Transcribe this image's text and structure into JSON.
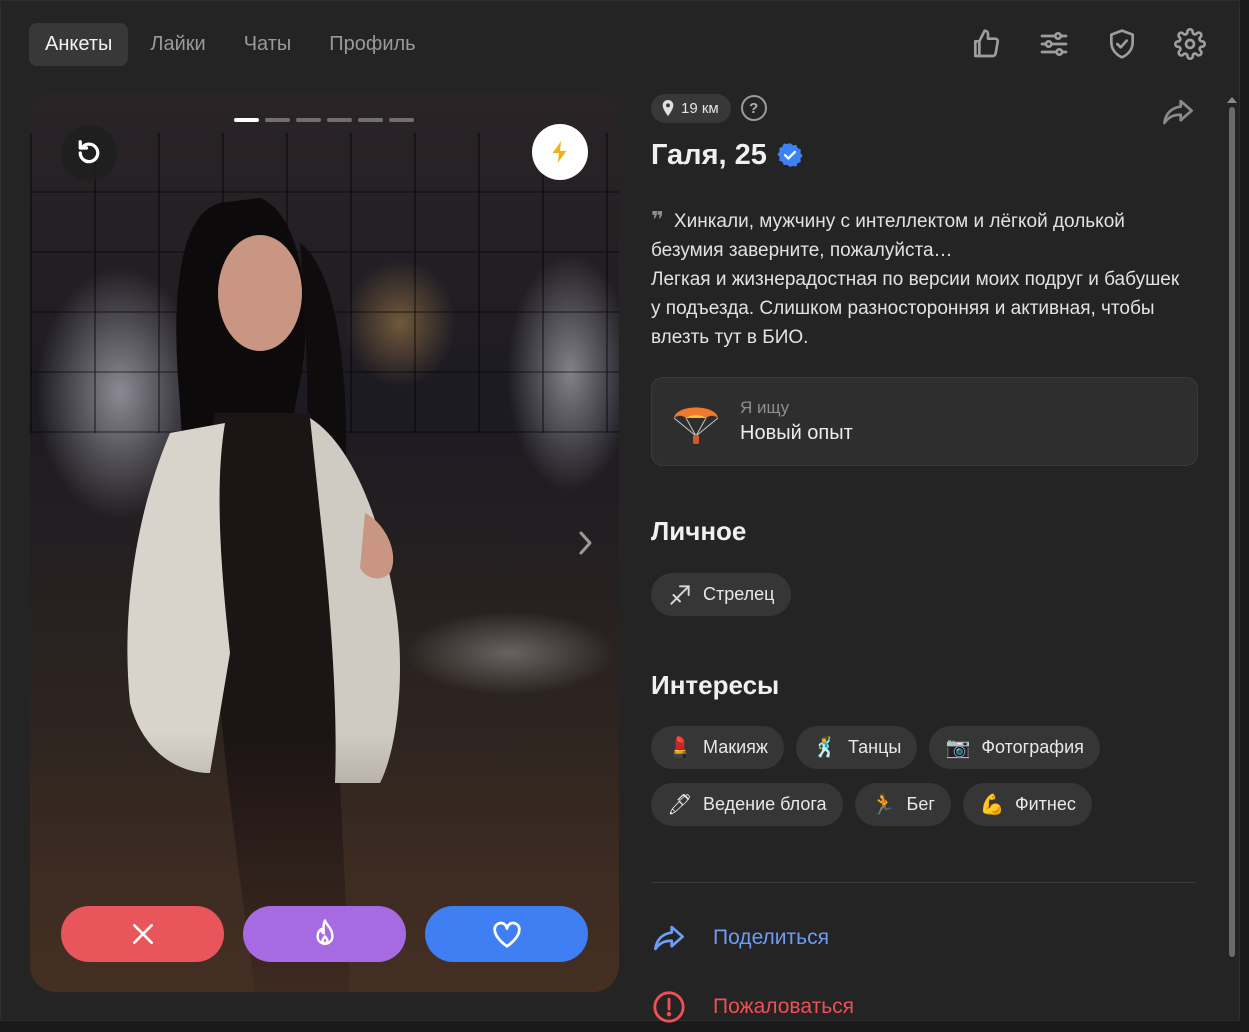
{
  "nav": {
    "tabs": [
      {
        "label": "Анкеты",
        "active": true
      },
      {
        "label": "Лайки",
        "active": false
      },
      {
        "label": "Чаты",
        "active": false
      },
      {
        "label": "Профиль",
        "active": false
      }
    ],
    "icons": [
      "thumbs-up-icon",
      "filters-icon",
      "shield-check-icon",
      "gear-icon"
    ]
  },
  "photo": {
    "count": 6,
    "current": 1,
    "icons": {
      "undo": "undo-icon",
      "boost": "lightning-icon",
      "next": "chevron-right-icon"
    }
  },
  "actions": {
    "dislike_icon": "close-icon",
    "super_icon": "flame-icon",
    "like_icon": "heart-icon",
    "colors": {
      "dislike": "#e8555b",
      "super": "#a66ae3",
      "like": "#3f7ef3"
    }
  },
  "profile": {
    "distance": "19 км",
    "help": "?",
    "name_age": "Галя, 25",
    "verified": true,
    "bio_line1": "Хинкали, мужчину с интеллектом и лёгкой долькой безумия заверните, пожалуйста…",
    "bio_line2": "Легкая и жизнерадостная по версии моих подруг и бабушек у подъезда. Слишком разносторонняя и активная, чтобы влезть тут в БИО.",
    "seeking_label": "Я ищу",
    "seeking_value": "Новый опыт"
  },
  "personal": {
    "title": "Личное",
    "chips": [
      {
        "label": "Стрелец",
        "icon": "sagittarius-icon"
      }
    ]
  },
  "interests": {
    "title": "Интересы",
    "chips": [
      {
        "label": "Макияж",
        "icon": "lipstick-icon",
        "glyph": "💄"
      },
      {
        "label": "Танцы",
        "icon": "dancer-icon",
        "glyph": "🕺"
      },
      {
        "label": "Фотография",
        "icon": "camera-icon",
        "glyph": "📷"
      },
      {
        "label": "Ведение блога",
        "icon": "pen-icon",
        "glyph": "🖊"
      },
      {
        "label": "Бег",
        "icon": "runner-icon",
        "glyph": "🏃"
      },
      {
        "label": "Фитнес",
        "icon": "biceps-icon",
        "glyph": "💪"
      }
    ]
  },
  "links": {
    "share": "Поделиться",
    "report": "Пожаловаться",
    "colors": {
      "share": "#6f9cf4",
      "report": "#ef4f55"
    }
  }
}
